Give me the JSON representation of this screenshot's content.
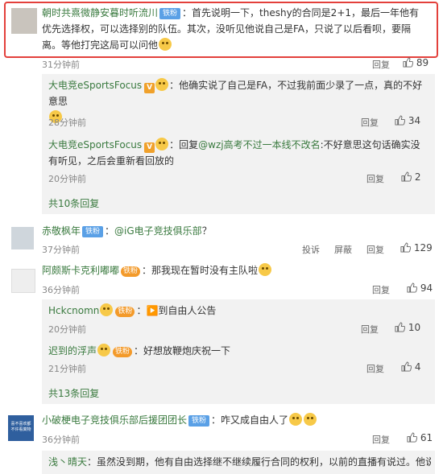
{
  "comments": [
    {
      "user": "朝时共熹微静安暮时听流川",
      "badge": "铁粉",
      "text": "：首先说明一下，theshy的合同是2+1，最后一年他有优先选择权，可以选择别的队伍。其次，没听见他说自己是FA，只说了以后看呗，要隔离。等他打完这局可以问他",
      "time": "31分钟前",
      "reply_label": "回复",
      "likes": "89",
      "replies": [
        {
          "user": "大电竞eSportsFocus",
          "text": "：他确实说了自己是FA，不过我前面少录了一点，真的不好意思",
          "time": "28分钟前",
          "reply_label": "回复",
          "likes": "34"
        },
        {
          "user": "大电竞eSportsFocus",
          "text_pre": "：回复",
          "mention": "@wzj高考不过一本线不改名",
          "text": ":不好意思这句话确实没有听见，之后会重新看回放的",
          "time": "20分钟前",
          "reply_label": "回复",
          "likes": "2"
        }
      ],
      "more": "共10条回复"
    },
    {
      "user": "赤敬枫年",
      "badge": "铁粉",
      "text_pre": "：",
      "mention": "@iG电子竞技俱乐部",
      "text": "？",
      "time": "37分钟前",
      "report_label": "投诉",
      "block_label": "屏蔽",
      "reply_label": "回复",
      "likes": "129"
    },
    {
      "user": "阿颇斯卡克利嘟嘟",
      "badge": "铁粉",
      "text": "：那我现在暂时没有主队啦",
      "time": "36分钟前",
      "reply_label": "回复",
      "likes": "94",
      "replies": [
        {
          "user": "Hckcnomn",
          "text": "：▶️到自由人公告",
          "time": "20分钟前",
          "reply_label": "回复",
          "likes": "10"
        },
        {
          "user": "迟到的浮声",
          "text": "：好想放鞭炮庆祝一下",
          "time": "21分钟前",
          "reply_label": "回复",
          "likes": "4"
        }
      ],
      "more": "共13条回复"
    },
    {
      "user": "小破梗电子竞技俱乐部后援团团长",
      "badge": "铁粉",
      "text": "：咋又成自由人了",
      "time": "36分钟前",
      "reply_label": "回复",
      "likes": "61",
      "avatar_text": "喜不喜欢都\n不许看粪物"
    },
    {
      "user": "浅丶晴天",
      "text": "：虽然没到期，他有自由选择继不继续履行合同的权利，以前的直播有说过。他说的"
    }
  ],
  "colors": {
    "name": "#3a7a3f",
    "badge": "#5aa0e6",
    "highlight": "#e3403b",
    "reply_bg": "#f2f2f2"
  }
}
